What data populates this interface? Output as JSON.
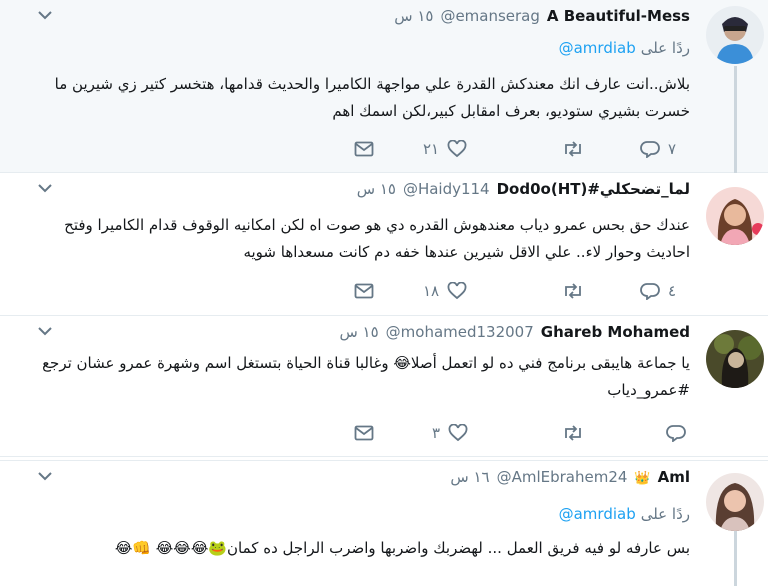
{
  "tweets": [
    {
      "name": "A Beautiful-Mess",
      "handle": "@emanserag",
      "time": "١٥ س",
      "reply_prefix": "ردًا على",
      "reply_handle": "@amrdiab",
      "text": "بلاش..انت عارف انك معندكش القدرة علي مواجهة الكاميرا والحديث قدامها، هتخسر كتير زي شيرين ما خسرت بشيري ستوديو، بعرف امقابل كبير،لكن اسمك اهم",
      "replies": "٧",
      "retweets": "",
      "likes": "٢١"
    },
    {
      "name": "Dod0o(HT)#لما_تضحكلي",
      "handle": "@Haidy114",
      "time": "١٥ س",
      "text": "عندك حق بحس عمرو دياب معندهوش القدره دي هو صوت اه لكن امكانيه الوقوف قدام الكاميرا وفتح احاديث وحوار لاء.. علي الاقل شيرين عندها خفه دم كانت مسعداها شويه",
      "replies": "٤",
      "retweets": "",
      "likes": "١٨"
    },
    {
      "name": "Ghareb Mohamed",
      "handle": "@mohamed132007",
      "time": "١٥ س",
      "text": "يا جماعة هايبقى برنامج فني ده لو اتعمل أصلا😂 وغالبا قناة الحياة بتستغل اسم وشهرة عمرو عشان ترجع #عمرو_دياب",
      "replies": "",
      "retweets": "",
      "likes": "٣"
    },
    {
      "name": "Aml",
      "name_badge": "👑",
      "handle": "@AmlEbrahem24",
      "time": "١٦ س",
      "reply_prefix": "ردًا على",
      "reply_handle": "@amrdiab",
      "text": "بس عارفه لو فيه فريق العمل ...  لهضربك واضربها واضرب الراجل ده كمان🐸😂😂😂 👊😂"
    }
  ],
  "icons": {
    "reply": "reply-icon",
    "retweet": "retweet-icon",
    "like": "heart-icon",
    "dm": "envelope-icon",
    "caret": "chevron-down-icon"
  },
  "colors": {
    "name": "#14171a",
    "meta": "#657786",
    "link": "#1da1f2",
    "highlight_bg": "#f5f8fa",
    "divider": "#e6ecf0",
    "thread_line": "#ccd6dd"
  }
}
